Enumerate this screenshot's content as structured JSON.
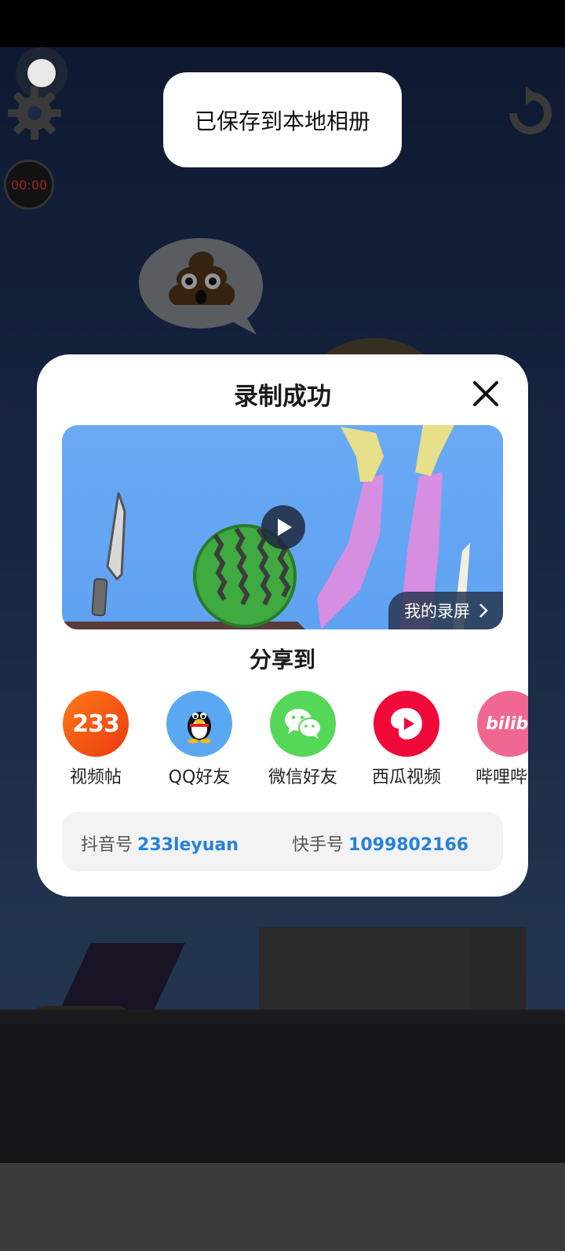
{
  "toast": {
    "message": "已保存到本地相册"
  },
  "hud": {
    "timer": "00:00"
  },
  "dialog": {
    "title": "录制成功",
    "my_recordings_label": "我的录屏",
    "share_title": "分享到",
    "share_targets": [
      {
        "label": "视频帖",
        "icon": "233-icon",
        "icon_text": "233",
        "color": "#f04a12"
      },
      {
        "label": "QQ好友",
        "icon": "qq-penguin-icon",
        "color": "#5aa8f2"
      },
      {
        "label": "微信好友",
        "icon": "wechat-icon",
        "color": "#55d858"
      },
      {
        "label": "西瓜视频",
        "icon": "xigua-video-icon",
        "color": "#ef0a3a"
      },
      {
        "label": "哔哩哔哩",
        "icon": "bilibili-icon",
        "icon_text": "bilibi",
        "color": "#f06791"
      }
    ],
    "ids": {
      "douyin_label": "抖音号",
      "douyin_value": "233leyuan",
      "kuaishou_label": "快手号",
      "kuaishou_value": "1099802166"
    }
  }
}
